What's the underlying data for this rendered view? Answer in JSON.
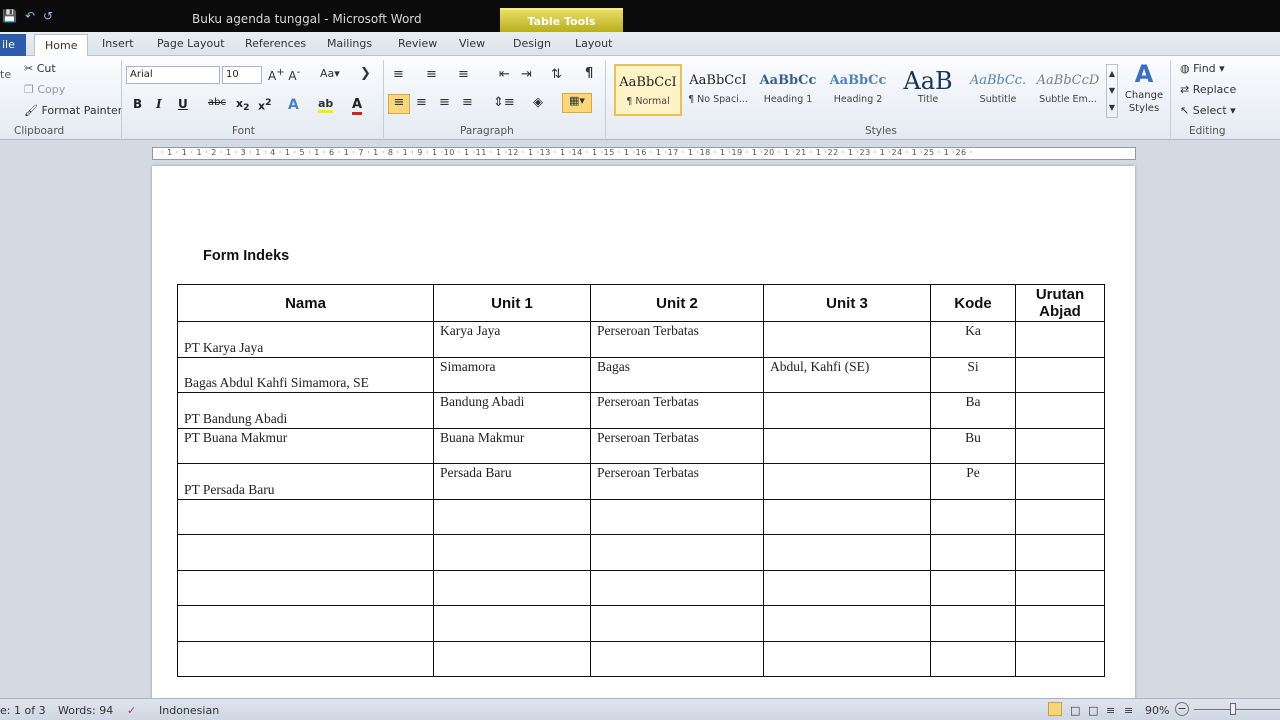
{
  "window": {
    "title": "Buku agenda tunggal  -  Microsoft Word",
    "context_tab": "Table Tools"
  },
  "tabs": [
    {
      "label": "ile"
    },
    {
      "label": "Home"
    },
    {
      "label": "Insert"
    },
    {
      "label": "Page Layout"
    },
    {
      "label": "References"
    },
    {
      "label": "Mailings"
    },
    {
      "label": "Review"
    },
    {
      "label": "View"
    },
    {
      "label": "Design"
    },
    {
      "label": "Layout"
    }
  ],
  "clipboard": {
    "cut": "Cut",
    "copy": "Copy",
    "format_painter": "Format Painter",
    "label": "Clipboard",
    "paste_fragment": "te"
  },
  "font": {
    "name": "Arial",
    "size": "10",
    "label": "Font"
  },
  "paragraph": {
    "label": "Paragraph"
  },
  "styles": {
    "label": "Styles",
    "items": [
      {
        "sample": "AaBbCcI",
        "name": "¶ Normal"
      },
      {
        "sample": "AaBbCcI",
        "name": "¶ No Spaci..."
      },
      {
        "sample": "AaBbCс",
        "name": "Heading 1"
      },
      {
        "sample": "AaBbCc",
        "name": "Heading 2"
      },
      {
        "sample": "AaB",
        "name": "Title"
      },
      {
        "sample": "AaBbCc.",
        "name": "Subtitle"
      },
      {
        "sample": "AaBbCcD",
        "name": "Subtle Em..."
      }
    ],
    "change_styles": "Change Styles"
  },
  "editing": {
    "find": "Find",
    "replace": "Replace",
    "select": "Select",
    "label": "Editing"
  },
  "ruler": {
    "text": "· 1 · 1 · 1 · 2 · 1 · 3 · 1 · 4 · 1 · 5 · 1 · 6 · 1 · 7 · 1 · 8 · 1 · 9 · 1 ·10 · 1 ·11 · 1 ·12 · 1 ·13 · 1 ·14 · 1 ·15 · 1 ·16 · 1 ·17 · 1 ·18 · 1 ·19 · 1 ·20 · 1 ·21 · 1 ·22 · 1 ·23 · 1 ·24 · 1 ·25 · 1 ·26 ·"
  },
  "document": {
    "heading": "Form Indeks",
    "headers": [
      "Nama",
      "Unit 1",
      "Unit 2",
      "Unit 3",
      "Kode",
      "Urutan Abjad"
    ],
    "rows": [
      {
        "nama": "PT Karya Jaya",
        "unit1": "Karya Jaya",
        "unit2": "Perseroan Terbatas",
        "unit3": "",
        "kode": "Ka",
        "urutan": ""
      },
      {
        "nama": "Bagas Abdul Kahfi Simamora,  SE",
        "unit1": "Simamora",
        "unit2": "Bagas",
        "unit3": "Abdul, Kahfi (SE)",
        "kode": "Si",
        "urutan": ""
      },
      {
        "nama": "PT Bandung Abadi",
        "unit1": "Bandung Abadi",
        "unit2": "Perseroan Terbatas",
        "unit3": "",
        "kode": "Ba",
        "urutan": ""
      },
      {
        "nama": "PT Buana Makmur",
        "unit1": "Buana Makmur",
        "unit2": "Perseroan Terbatas",
        "unit3": "",
        "kode": "Bu",
        "urutan": ""
      },
      {
        "nama": "PT Persada Baru",
        "unit1": "Persada Baru",
        "unit2": "Perseroan Terbatas",
        "unit3": "",
        "kode": "Pe",
        "urutan": ""
      }
    ]
  },
  "status": {
    "page": "e: 1 of 3",
    "words": "Words: 94",
    "language": "Indonesian",
    "zoom": "90%"
  }
}
